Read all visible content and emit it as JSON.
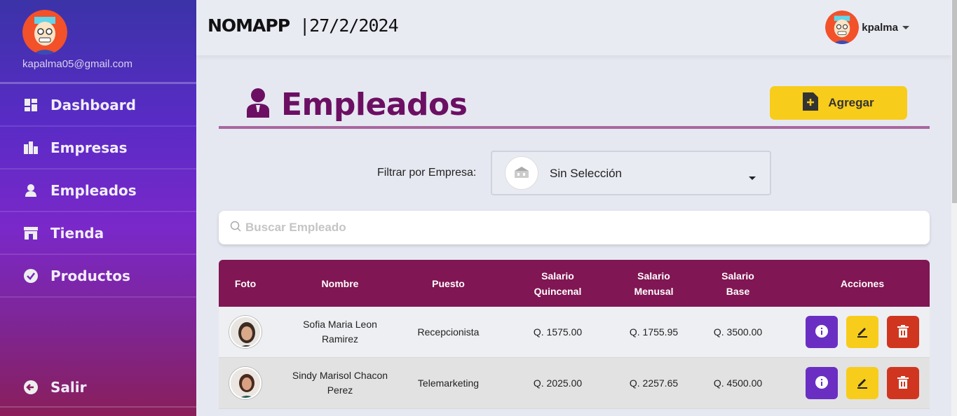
{
  "sidebar": {
    "email": "kapalma05@gmail.com",
    "items": [
      {
        "label": "Dashboard",
        "icon": "dashboard-icon"
      },
      {
        "label": "Empresas",
        "icon": "buildings-icon"
      },
      {
        "label": "Empleados",
        "icon": "person-icon"
      },
      {
        "label": "Tienda",
        "icon": "store-icon"
      },
      {
        "label": "Productos",
        "icon": "check-badge-icon"
      }
    ],
    "logout_label": "Salir"
  },
  "header": {
    "brand": "NOMAPP",
    "date": "|27/2/2024",
    "username": "kpalma"
  },
  "page": {
    "title": "Empleados",
    "add_label": "Agregar"
  },
  "filter": {
    "label": "Filtrar por Empresa:",
    "selected": "Sin Selección"
  },
  "search": {
    "placeholder": "Buscar Empleado"
  },
  "table": {
    "headers": {
      "foto": "Foto",
      "nombre": "Nombre",
      "puesto": "Puesto",
      "quincenal_1": "Salario",
      "quincenal_2": "Quincenal",
      "mensual_1": "Salario",
      "mensual_2": "Menusal",
      "base_1": "Salario",
      "base_2": "Base",
      "acciones": "Acciones"
    },
    "rows": [
      {
        "name_1": "Sofia Maria Leon",
        "name_2": "Ramirez",
        "puesto": "Recepcionista",
        "quincenal": "Q. 1575.00",
        "mensual": "Q. 1755.95",
        "base": "Q. 3500.00"
      },
      {
        "name_1": "Sindy Marisol Chacon",
        "name_2": "Perez",
        "puesto": "Telemarketing",
        "quincenal": "Q. 2025.00",
        "mensual": "Q. 2257.65",
        "base": "Q. 4500.00"
      }
    ]
  },
  "colors": {
    "accent": "#801653",
    "title": "#6c0f63",
    "add": "#f8cc1b",
    "info": "#6a2fc2",
    "delete": "#d0361f"
  }
}
